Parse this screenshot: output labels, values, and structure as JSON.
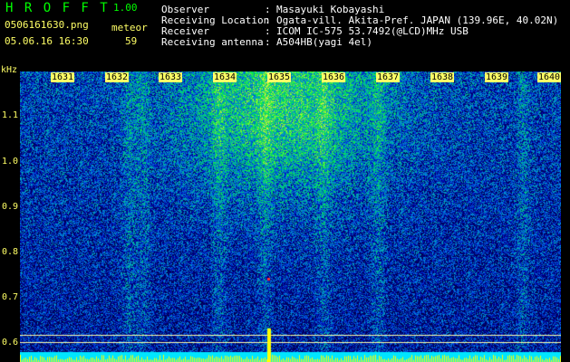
{
  "header": {
    "app_title": "H R O F F T",
    "app_version": "1.00",
    "file_name": "0506161630.png",
    "event_label": "meteor",
    "date_time": "05.06.16 16:30",
    "event_count": "59"
  },
  "station_info": [
    {
      "label": "Observer",
      "value": "Masayuki Kobayashi"
    },
    {
      "label": "Receiving Location",
      "value": "Ogata-vill. Akita-Pref. JAPAN (139.96E, 40.02N)"
    },
    {
      "label": "Receiver",
      "value": "ICOM IC-575 53.7492(@LCD)MHz USB"
    },
    {
      "label": "Receiving antenna",
      "value": "A504HB(yagi 4el)"
    }
  ],
  "spectrogram": {
    "unit_label": "kHz",
    "y_labels": [
      "1.1",
      "1.0",
      "0.9",
      "0.8",
      "0.7",
      "0.6"
    ],
    "minute_labels": [
      "1631",
      "1632",
      "1633",
      "1634",
      "1635",
      "1636",
      "1637",
      "1638",
      "1639",
      "1640"
    ]
  }
}
